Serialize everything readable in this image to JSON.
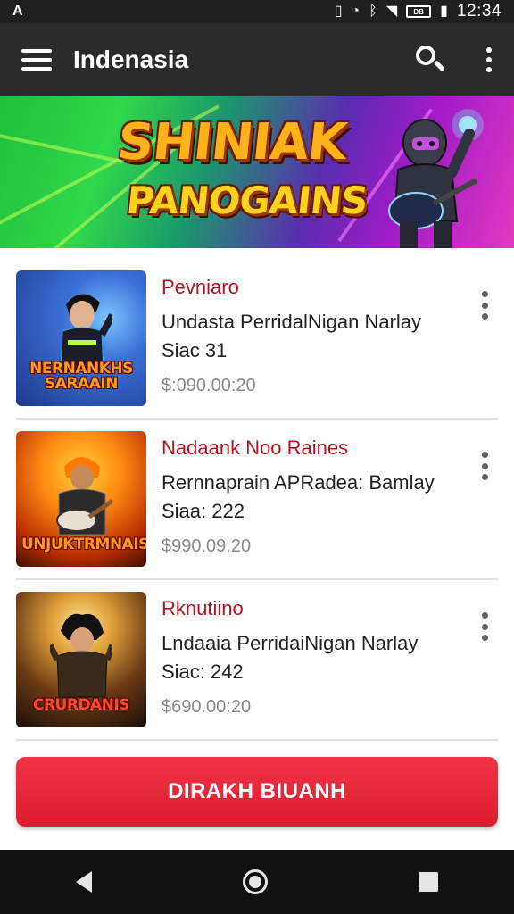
{
  "status_bar": {
    "left_icon": "A",
    "time": "12:34",
    "battery_label": "DB",
    "icons": [
      "phone-icon",
      "alarm-icon",
      "bluetooth-icon",
      "wifi-icon",
      "battery-icon",
      "signal-icon"
    ]
  },
  "app_bar": {
    "title": "Indenasia",
    "icons": [
      "menu-icon",
      "search-icon",
      "more-vert-icon"
    ]
  },
  "banner": {
    "title": "SHINIAK",
    "subtitle": "PANOGAINS"
  },
  "items": [
    {
      "thumb_caption": "NERNANKHS SARAAIN",
      "title": "Pevniaro",
      "desc_line1": "Undasta PerridalNigan Narlay",
      "desc_line2": "Siac 31",
      "price": "$:090.00:20",
      "thumb_colors": [
        "#1c3a8a",
        "#3b6fd6"
      ]
    },
    {
      "thumb_caption": "UNJUKTRMNAIS",
      "title": "Nadaank Noo Raines",
      "desc_line1": "Rernnaprain APRadea: Bamlay",
      "desc_line2": "Siaa: 222",
      "price": "$990.09.20",
      "thumb_colors": [
        "#b32a00",
        "#ff8a12"
      ]
    },
    {
      "thumb_caption": "CRURDANIS",
      "title": "Rknutiino",
      "desc_line1": "Lndaaia PerridaiNigan Narlay",
      "desc_line2": "Siac: 242",
      "price": "$690.00:20",
      "thumb_colors": [
        "#2a1a0a",
        "#c2781a"
      ]
    }
  ],
  "cta": {
    "label": "DIRAKH BIUANH"
  },
  "colors": {
    "accent": "#dc1c30",
    "title_red": "#b3121f",
    "app_bar": "#2b2b2b"
  }
}
